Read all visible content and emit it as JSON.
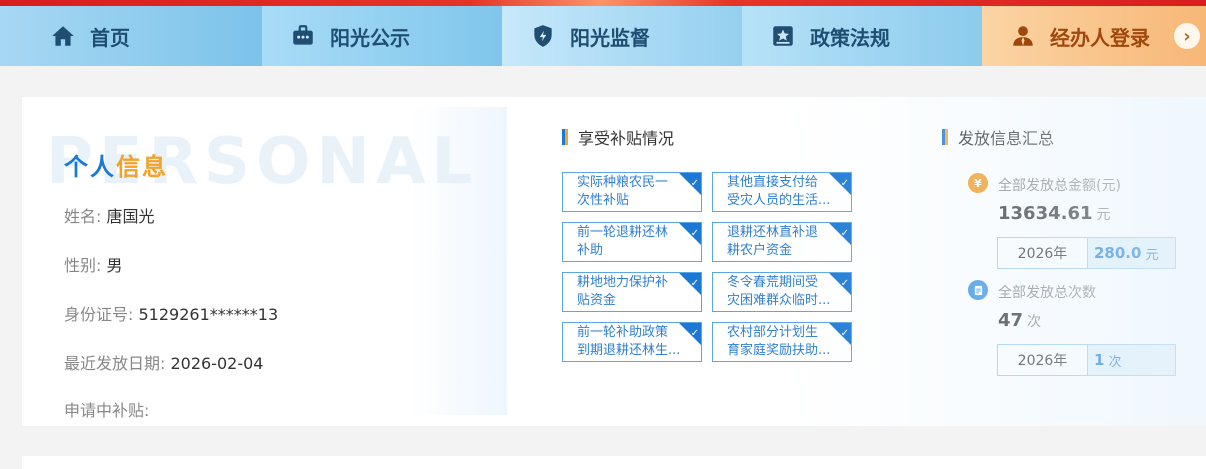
{
  "nav": {
    "items": [
      {
        "label": "首页",
        "icon": "home-icon"
      },
      {
        "label": "阳光公示",
        "icon": "briefcase-icon"
      },
      {
        "label": "阳光监督",
        "icon": "shield-icon"
      },
      {
        "label": "政策法规",
        "icon": "star-document-icon"
      },
      {
        "label": "经办人登录",
        "icon": "user-icon"
      }
    ],
    "arrow": "›"
  },
  "personal": {
    "watermark": "PERSONAL",
    "title_a": "个人",
    "title_b": "信息",
    "name_label": "姓名:",
    "name": "唐国光",
    "gender_label": "性别:",
    "gender": "男",
    "id_label": "身份证号:",
    "id": "5129261******13",
    "last_date_label": "最近发放日期:",
    "last_date": "2026-02-04",
    "applying_label": "申请中补贴:"
  },
  "subsidies": {
    "title": "享受补贴情况",
    "items": [
      {
        "l1": "实际种粮农民一",
        "l2": "次性补贴"
      },
      {
        "l1": "其他直接支付给",
        "l2": "受灾人员的生活..."
      },
      {
        "l1": "前一轮退耕还林",
        "l2": "补助"
      },
      {
        "l1": "退耕还林直补退",
        "l2": "耕农户资金"
      },
      {
        "l1": "耕地地力保护补",
        "l2": "贴资金"
      },
      {
        "l1": "冬令春荒期间受",
        "l2": "灾困难群众临时..."
      },
      {
        "l1": "前一轮补助政策",
        "l2": "到期退耕还林生..."
      },
      {
        "l1": "农村部分计划生",
        "l2": "育家庭奖励扶助..."
      }
    ]
  },
  "summary": {
    "title": "发放信息汇总",
    "amount_icon": "¥",
    "amount_label": "全部发放总金额(元)",
    "amount_value": "13634.61",
    "amount_unit": "元",
    "amount_year": "2026年",
    "amount_year_value": "280.0",
    "amount_year_unit": "元",
    "count_label": "全部发放总次数",
    "count_value": "47",
    "count_unit": "次",
    "count_year": "2026年",
    "count_year_value": "1",
    "count_year_unit": "次"
  },
  "colors": {
    "accent_blue": "#1b78d6",
    "accent_orange": "#f2a22b",
    "top_red": "#d81e1e"
  }
}
